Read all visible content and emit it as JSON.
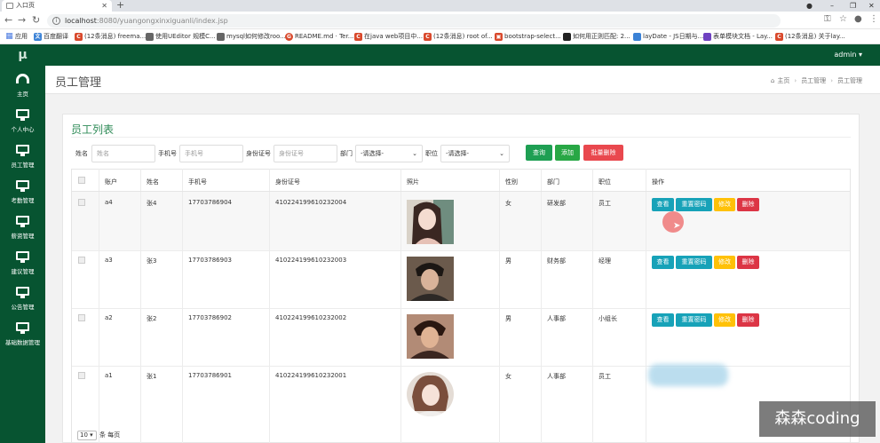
{
  "browser": {
    "tab_title": "入口页",
    "url_host": "localhost",
    "url_path": ":8080/yuangongxinxiguanli/index.jsp",
    "bookmarks": [
      "应用",
      "百度翻译",
      "(12条消息) freema...",
      "使用UEditor 规模C...",
      "mysql如何修改roo...",
      "README.md · Ter...",
      "在java web项目中...",
      "(12条消息) root of...",
      "bootstrap-select...",
      "如何用正则匹配: 2...",
      "layDate - JS日期与...",
      "表单模块文档 - Lay...",
      "(12条消息) 关于lay..."
    ]
  },
  "app": {
    "logo": "μ",
    "user": "admin ▾",
    "sidebar": [
      "主页",
      "个人中心",
      "员工管理",
      "考勤管理",
      "薪资管理",
      "建议管理",
      "公告管理",
      "基础数据管理"
    ],
    "page_title": "员工管理",
    "breadcrumb": [
      "主页",
      "员工管理",
      "员工管理"
    ]
  },
  "panel": {
    "title": "员工列表",
    "filters": {
      "name_label": "姓名",
      "name_placeholder": "姓名",
      "phone_label": "手机号",
      "phone_placeholder": "手机号",
      "id_label": "身份证号",
      "id_placeholder": "身份证号",
      "dept_label": "部门",
      "dept_value": "-请选择-",
      "pos_label": "职位",
      "pos_value": "-请选择-"
    },
    "buttons": {
      "search": "查询",
      "add": "添加",
      "batch_delete": "批量删除"
    }
  },
  "table": {
    "headers": [
      "账户",
      "姓名",
      "手机号",
      "身份证号",
      "照片",
      "性别",
      "部门",
      "职位",
      "操作"
    ],
    "rows": [
      {
        "account": "a4",
        "name": "张4",
        "phone": "17703786904",
        "idcard": "410224199610232004",
        "gender": "女",
        "dept": "研发部",
        "position": "员工"
      },
      {
        "account": "a3",
        "name": "张3",
        "phone": "17703786903",
        "idcard": "410224199610232003",
        "gender": "男",
        "dept": "财务部",
        "position": "经理"
      },
      {
        "account": "a2",
        "name": "张2",
        "phone": "17703786902",
        "idcard": "410224199610232002",
        "gender": "男",
        "dept": "人事部",
        "position": "小组长"
      },
      {
        "account": "a1",
        "name": "张1",
        "phone": "17703786901",
        "idcard": "410224199610232001",
        "gender": "女",
        "dept": "人事部",
        "position": "员工"
      }
    ],
    "actions": {
      "view": "查看",
      "reset": "重置密码",
      "edit": "修改",
      "delete": "删除"
    }
  },
  "pager": {
    "size": "10 ▾",
    "label": "条 每页"
  },
  "watermark": "森森coding"
}
